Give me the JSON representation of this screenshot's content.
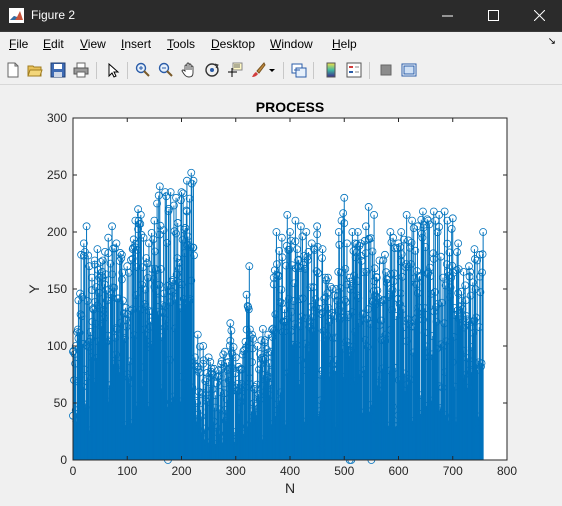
{
  "window": {
    "title": "Figure 2",
    "controls": [
      "minimize",
      "maximize",
      "close"
    ]
  },
  "menu": {
    "items": [
      {
        "label": "File",
        "key": "F",
        "rest": "ile"
      },
      {
        "label": "Edit",
        "key": "E",
        "rest": "dit"
      },
      {
        "label": "View",
        "key": "V",
        "rest": "iew"
      },
      {
        "label": "Insert",
        "key": "I",
        "rest": "nsert"
      },
      {
        "label": "Tools",
        "key": "T",
        "rest": "ools"
      },
      {
        "label": "Desktop",
        "key": "D",
        "rest": "esktop"
      },
      {
        "label": "Window",
        "key": "W",
        "rest": "indow"
      },
      {
        "label": "Help",
        "key": "H",
        "rest": "elp"
      }
    ]
  },
  "toolbar": {
    "icons": [
      "new-figure-icon",
      "open-file-icon",
      "save-icon",
      "print-icon",
      "edit-plot-icon",
      "zoom-in-icon",
      "zoom-out-icon",
      "pan-icon",
      "rotate-3d-icon",
      "data-cursor-icon",
      "brush-icon",
      "link-plot-icon",
      "colorbar-icon",
      "legend-icon",
      "hide-plot-tools-icon",
      "show-plot-tools-icon"
    ]
  },
  "colors": {
    "series": "#0072bd",
    "titlebar": "#2b2b2b",
    "figure_bg": "#f0f0f0"
  },
  "chart_data": {
    "type": "stem",
    "title": "PROCESS",
    "xlabel": "N",
    "ylabel": "Y",
    "xlim": [
      0,
      800
    ],
    "ylim": [
      0,
      300
    ],
    "xticks": [
      0,
      100,
      200,
      300,
      400,
      500,
      600,
      700,
      800
    ],
    "yticks": [
      0,
      50,
      100,
      150,
      200,
      250,
      300
    ],
    "grid": false,
    "marker": "circle",
    "n_points": 756,
    "envelope": [
      [
        0,
        95
      ],
      [
        5,
        100
      ],
      [
        10,
        140
      ],
      [
        15,
        180
      ],
      [
        20,
        190
      ],
      [
        25,
        205
      ],
      [
        30,
        170
      ],
      [
        35,
        160
      ],
      [
        40,
        175
      ],
      [
        45,
        185
      ],
      [
        55,
        175
      ],
      [
        65,
        195
      ],
      [
        72,
        205
      ],
      [
        80,
        190
      ],
      [
        90,
        180
      ],
      [
        100,
        170
      ],
      [
        110,
        185
      ],
      [
        115,
        210
      ],
      [
        120,
        220
      ],
      [
        125,
        215
      ],
      [
        130,
        195
      ],
      [
        140,
        190
      ],
      [
        150,
        210
      ],
      [
        155,
        225
      ],
      [
        160,
        240
      ],
      [
        170,
        235
      ],
      [
        180,
        235
      ],
      [
        190,
        230
      ],
      [
        200,
        235
      ],
      [
        210,
        245
      ],
      [
        218,
        252
      ],
      [
        222,
        245
      ],
      [
        225,
        90
      ],
      [
        230,
        110
      ],
      [
        240,
        100
      ],
      [
        250,
        90
      ],
      [
        260,
        80
      ],
      [
        280,
        95
      ],
      [
        290,
        120
      ],
      [
        300,
        90
      ],
      [
        310,
        80
      ],
      [
        320,
        145
      ],
      [
        325,
        170
      ],
      [
        330,
        110
      ],
      [
        340,
        100
      ],
      [
        350,
        115
      ],
      [
        360,
        110
      ],
      [
        365,
        95
      ],
      [
        370,
        160
      ],
      [
        375,
        200
      ],
      [
        385,
        195
      ],
      [
        395,
        215
      ],
      [
        400,
        200
      ],
      [
        410,
        210
      ],
      [
        420,
        205
      ],
      [
        430,
        200
      ],
      [
        440,
        190
      ],
      [
        450,
        205
      ],
      [
        460,
        185
      ],
      [
        465,
        160
      ],
      [
        470,
        160
      ],
      [
        478,
        150
      ],
      [
        485,
        150
      ],
      [
        490,
        200
      ],
      [
        495,
        210
      ],
      [
        500,
        230
      ],
      [
        505,
        190
      ],
      [
        510,
        160
      ],
      [
        515,
        200
      ],
      [
        520,
        190
      ],
      [
        525,
        200
      ],
      [
        530,
        190
      ],
      [
        540,
        205
      ],
      [
        545,
        222
      ],
      [
        555,
        215
      ],
      [
        560,
        160
      ],
      [
        565,
        175
      ],
      [
        575,
        180
      ],
      [
        585,
        200
      ],
      [
        590,
        195
      ],
      [
        600,
        190
      ],
      [
        605,
        200
      ],
      [
        615,
        215
      ],
      [
        625,
        210
      ],
      [
        635,
        205
      ],
      [
        645,
        218
      ],
      [
        655,
        210
      ],
      [
        665,
        218
      ],
      [
        675,
        215
      ],
      [
        685,
        218
      ],
      [
        690,
        210
      ],
      [
        700,
        212
      ],
      [
        710,
        190
      ],
      [
        720,
        165
      ],
      [
        730,
        170
      ],
      [
        740,
        185
      ],
      [
        745,
        175
      ],
      [
        750,
        180
      ],
      [
        756,
        200
      ]
    ],
    "dips": [
      {
        "x": 175,
        "y": 0
      },
      {
        "x": 458,
        "y": 10
      },
      {
        "x": 510,
        "y": 0
      },
      {
        "x": 513,
        "y": 0
      },
      {
        "x": 550,
        "y": 0
      }
    ]
  }
}
